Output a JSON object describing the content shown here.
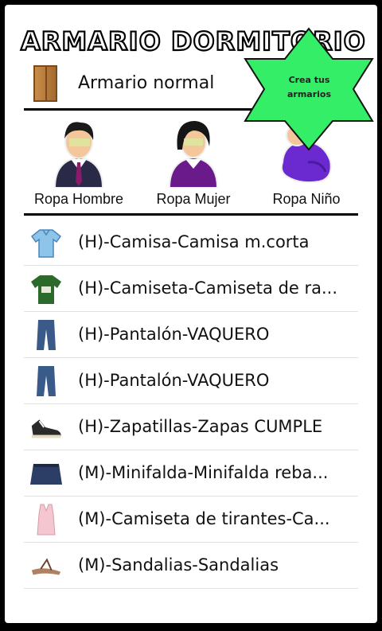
{
  "header": {
    "title": "ARMARIO DORMITORIO"
  },
  "wardrobe": {
    "name": "Armario normal"
  },
  "badge": {
    "line1": "Crea tus",
    "line2": "armarios",
    "color": "#33ee66"
  },
  "categories": [
    {
      "label": "Ropa Hombre",
      "icon": "man-icon"
    },
    {
      "label": "Ropa Mujer",
      "icon": "woman-icon"
    },
    {
      "label": "Ropa Niño",
      "icon": "baby-icon"
    }
  ],
  "items": [
    {
      "label": "(H)-Camisa-Camisa m.corta",
      "icon": "shirt-icon"
    },
    {
      "label": "(H)-Camiseta-Camiseta de ra...",
      "icon": "tshirt-icon"
    },
    {
      "label": "(H)-Pantalón-VAQUERO",
      "icon": "jeans-icon"
    },
    {
      "label": "(H)-Pantalón-VAQUERO",
      "icon": "jeans-icon"
    },
    {
      "label": "(H)-Zapatillas-Zapas CUMPLE",
      "icon": "sneaker-icon"
    },
    {
      "label": "(M)-Minifalda-Minifalda reba...",
      "icon": "skirt-icon"
    },
    {
      "label": "(M)-Camiseta de tirantes-Ca...",
      "icon": "tanktop-icon"
    },
    {
      "label": "(M)-Sandalias-Sandalias",
      "icon": "sandal-icon"
    }
  ]
}
